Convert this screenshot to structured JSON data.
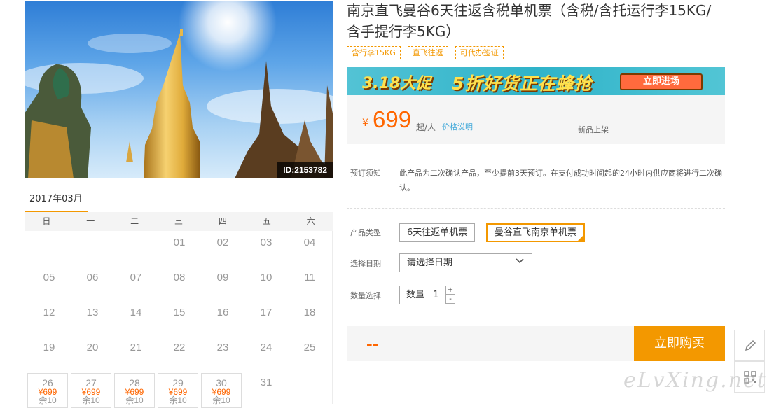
{
  "hero": {
    "image_id": "ID:2153782"
  },
  "product": {
    "title": "南京直飞曼谷6天往返含税单机票（含税/含托运行李15KG/含手提行李5KG）",
    "tags": [
      "含行李15KG",
      "直飞往返",
      "可代办签证"
    ]
  },
  "promo": {
    "left_text": "3.18大促",
    "main_text": "5折好货正在蜂抢",
    "button_label": "立即进场"
  },
  "price": {
    "currency": "¥",
    "amount": "699",
    "unit": "起/人",
    "explain_link": "价格说明",
    "new_tag": "新品上架"
  },
  "notice": {
    "label": "预订须知",
    "text": "此产品为二次确认产品，至少提前3天预订。在支付成功时间起的24小时内供应商将进行二次确认。"
  },
  "options": {
    "type_label": "产品类型",
    "types": [
      "6天往返单机票",
      "曼谷直飞南京单机票"
    ],
    "selected_type": 1,
    "date_label": "选择日期",
    "date_placeholder": "请选择日期",
    "qty_label": "数量选择",
    "qty_prefix": "数量",
    "qty_value": "1",
    "plus": "+",
    "minus": "-"
  },
  "buy": {
    "total": "--",
    "button_label": "立即购买"
  },
  "calendar": {
    "month": "2017年03月",
    "weekdays": [
      "日",
      "一",
      "二",
      "三",
      "四",
      "五",
      "六"
    ],
    "days": [
      {
        "d": "01",
        "col": 3,
        "row": 0
      },
      {
        "d": "02",
        "col": 4,
        "row": 0
      },
      {
        "d": "03",
        "col": 5,
        "row": 0
      },
      {
        "d": "04",
        "col": 6,
        "row": 0
      },
      {
        "d": "05",
        "col": 0,
        "row": 1
      },
      {
        "d": "06",
        "col": 1,
        "row": 1
      },
      {
        "d": "07",
        "col": 2,
        "row": 1
      },
      {
        "d": "08",
        "col": 3,
        "row": 1
      },
      {
        "d": "09",
        "col": 4,
        "row": 1
      },
      {
        "d": "10",
        "col": 5,
        "row": 1
      },
      {
        "d": "11",
        "col": 6,
        "row": 1
      },
      {
        "d": "12",
        "col": 0,
        "row": 2
      },
      {
        "d": "13",
        "col": 1,
        "row": 2
      },
      {
        "d": "14",
        "col": 2,
        "row": 2
      },
      {
        "d": "15",
        "col": 3,
        "row": 2
      },
      {
        "d": "16",
        "col": 4,
        "row": 2
      },
      {
        "d": "17",
        "col": 5,
        "row": 2
      },
      {
        "d": "18",
        "col": 6,
        "row": 2
      },
      {
        "d": "19",
        "col": 0,
        "row": 3
      },
      {
        "d": "20",
        "col": 1,
        "row": 3
      },
      {
        "d": "21",
        "col": 2,
        "row": 3
      },
      {
        "d": "22",
        "col": 3,
        "row": 3
      },
      {
        "d": "23",
        "col": 4,
        "row": 3
      },
      {
        "d": "24",
        "col": 5,
        "row": 3
      },
      {
        "d": "25",
        "col": 6,
        "row": 3
      },
      {
        "d": "26",
        "col": 0,
        "row": 4,
        "price": "¥699",
        "stock": "余10"
      },
      {
        "d": "27",
        "col": 1,
        "row": 4,
        "price": "¥699",
        "stock": "余10"
      },
      {
        "d": "28",
        "col": 2,
        "row": 4,
        "price": "¥699",
        "stock": "余10"
      },
      {
        "d": "29",
        "col": 3,
        "row": 4,
        "price": "¥699",
        "stock": "余10"
      },
      {
        "d": "30",
        "col": 4,
        "row": 4,
        "price": "¥699",
        "stock": "余10"
      },
      {
        "d": "31",
        "col": 5,
        "row": 4
      }
    ]
  },
  "watermark": "eLvXing.net",
  "colors": {
    "accent": "#f39800",
    "price": "#ff6600",
    "link": "#3fa8d9"
  }
}
